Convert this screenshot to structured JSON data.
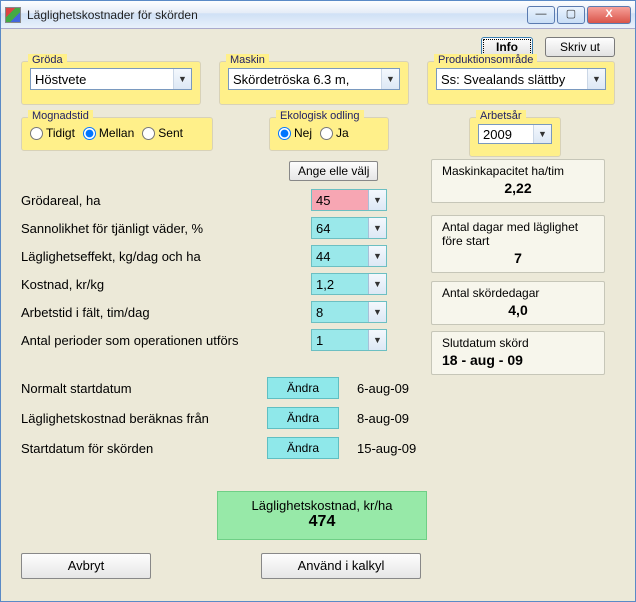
{
  "window": {
    "title": "Läglighetskostnader för skörden"
  },
  "topbuttons": {
    "info": "Info",
    "print": "Skriv ut"
  },
  "groda": {
    "legend": "Gröda",
    "value": "Höstvete"
  },
  "maskin": {
    "legend": "Maskin",
    "value": "Skördetröska   6.3 m,"
  },
  "omrade": {
    "legend": "Produktionsområde",
    "value": "Ss: Svealands slättby"
  },
  "mognadstid": {
    "legend": "Mognadstid",
    "options": {
      "tidigt": "Tidigt",
      "mellan": "Mellan",
      "sent": "Sent"
    },
    "selected": "mellan"
  },
  "ekologisk": {
    "legend": "Ekologisk odling",
    "options": {
      "nej": "Nej",
      "ja": "Ja"
    },
    "selected": "nej"
  },
  "arbetsar": {
    "legend": "Arbetsår",
    "value": "2009"
  },
  "angevalj": "Ange elle välj",
  "inputs": {
    "grodareal": {
      "label": "Grödareal, ha",
      "value": "45"
    },
    "sannolikhet": {
      "label": "Sannolikhet för tjänligt väder,  %",
      "value": "64"
    },
    "laglighetseffekt": {
      "label": "Läglighetseffekt, kg/dag och ha",
      "value": "44"
    },
    "kostnad": {
      "label": "Kostnad, kr/kg",
      "value": "1,2"
    },
    "arbetstid": {
      "label": "Arbetstid i fält, tim/dag",
      "value": "8"
    },
    "perioder": {
      "label": "Antal perioder som operationen utförs",
      "value": "1"
    }
  },
  "andra": "Ändra",
  "dates": {
    "normalt": {
      "label": "Normalt startdatum",
      "value": "6-aug-09"
    },
    "beraknas": {
      "label": "Läglighetskostnad beräknas från",
      "value": "8-aug-09"
    },
    "start": {
      "label": "Startdatum för skörden",
      "value": "15-aug-09"
    }
  },
  "cards": {
    "kapacitet": {
      "title": "Maskinkapacitet ha/tim",
      "value": "2,22"
    },
    "dagar": {
      "title": "Antal dagar med läglighet före start",
      "value": "7"
    },
    "skordedagar": {
      "title": "Antal skördedagar",
      "value": "4,0"
    },
    "slutdatum": {
      "title": "Slutdatum skörd",
      "value": "18 - aug - 09"
    }
  },
  "result": {
    "title": "Läglighetskostnad, kr/ha",
    "value": "474"
  },
  "bottom": {
    "avbryt": "Avbryt",
    "anvand": "Använd i kalkyl"
  }
}
